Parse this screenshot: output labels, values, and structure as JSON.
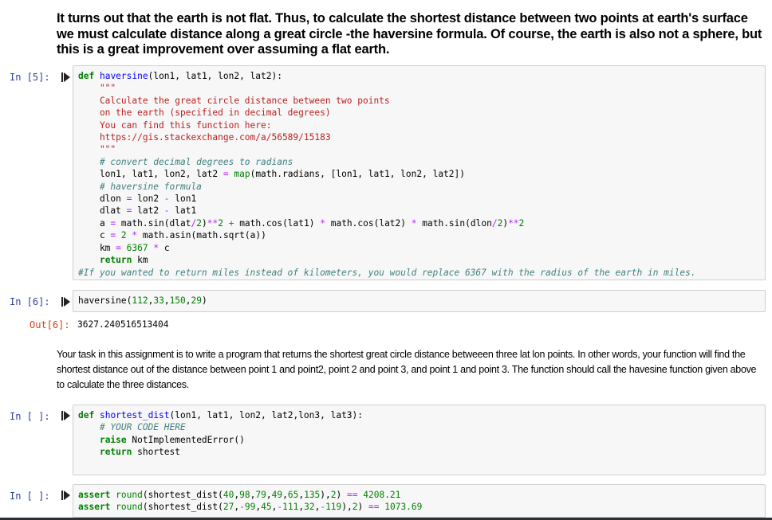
{
  "intro_text": "It turns out that the earth is not flat. Thus, to calculate the shortest distance between two points at earth's surface we must calculate distance along a great circle -the haversine formula. Of course, the earth is also not a sphere, but this is a great improvement over assuming a flat earth.",
  "cells": [
    {
      "prompt": "In [5]:",
      "lines": [
        "def haversine(lon1, lat1, lon2, lat2):",
        "    \"\"\"",
        "    Calculate the great circle distance between two points",
        "    on the earth (specified in decimal degrees)",
        "    You can find this function here:",
        "    https://gis.stackexchange.com/a/56589/15183",
        "    \"\"\"",
        "    # convert decimal degrees to radians",
        "    lon1, lat1, lon2, lat2 = map(math.radians, [lon1, lat1, lon2, lat2])",
        "    # haversine formula",
        "    dlon = lon2 - lon1",
        "    dlat = lat2 - lat1",
        "    a = math.sin(dlat/2)**2 + math.cos(lat1) * math.cos(lat2) * math.sin(dlon/2)**2",
        "    c = 2 * math.asin(math.sqrt(a))",
        "    km = 6367 * c",
        "    return km",
        "#If you wanted to return miles instead of kilometers, you would replace 6367 with the radius of the earth in miles."
      ]
    },
    {
      "prompt": "In [6]:",
      "lines": [
        "haversine(112,33,150,29)"
      ],
      "out_prompt": "Out[6]:",
      "output": "3627.240516513404"
    },
    {
      "prompt": "In [ ]:",
      "lines": [
        "def shortest_dist(lon1, lat1, lon2, lat2,lon3, lat3):",
        "    # YOUR CODE HERE",
        "    raise NotImplementedError()",
        "    return shortest"
      ]
    },
    {
      "prompt": "In [ ]:",
      "lines": [
        "assert round(shortest_dist(40,98,79,49,65,135),2) == 4208.21",
        "assert round(shortest_dist(27,-99,45,-111,32,-119),2) == 1073.69"
      ]
    }
  ],
  "task_text": "Your task in this assignment is to write a program that returns the shortest great circle distance betweeen three lat lon points. In other words, your function will find the shortest distance out of the distance between point 1 and point2, point 2 and point 3, and point 1 and point 3. The function should call the havesine function given above to calculate the three distances.",
  "icons": {
    "run": "run-cell-icon"
  }
}
